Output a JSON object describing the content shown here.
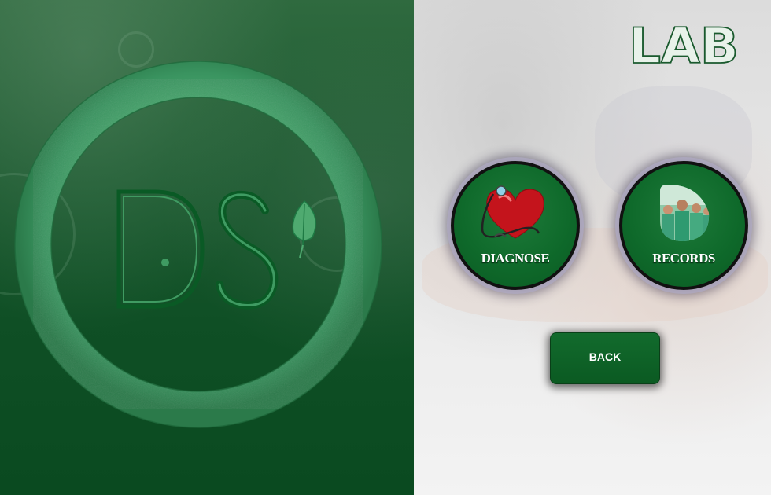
{
  "app": {
    "logo_text": "DS",
    "section_title": "LAB"
  },
  "buttons": {
    "diagnose": {
      "label": "DIAGNOSE",
      "icon": "heart-stethoscope-icon"
    },
    "records": {
      "label": "RECORDS",
      "icon": "medical-team-photo-icon"
    },
    "back": {
      "label": "BACK"
    }
  },
  "colors": {
    "brand_green": "#0f5a27",
    "ring_green": "#3d9a62",
    "button_green": "#0f6a2b",
    "heart_red": "#c4141c"
  }
}
